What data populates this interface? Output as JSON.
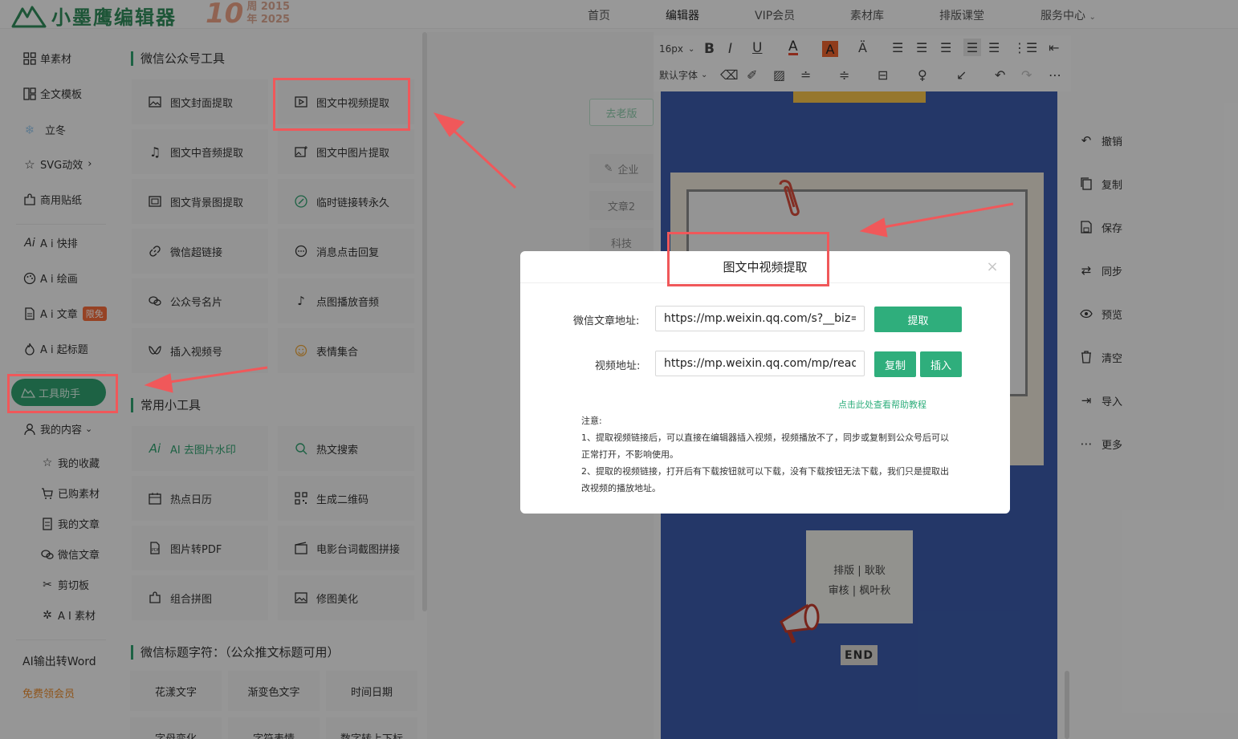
{
  "header": {
    "brand": "小墨鹰编辑器",
    "anniversary_number": "10",
    "anniversary_line1": "周 2015",
    "anniversary_line2": "年 2025",
    "nav": [
      {
        "label": "首页"
      },
      {
        "label": "编辑器"
      },
      {
        "label": "VIP会员"
      },
      {
        "label": "素材库"
      },
      {
        "label": "排版课堂"
      },
      {
        "label": "服务中心"
      }
    ]
  },
  "sidebar": {
    "items": [
      {
        "label": "单素材",
        "icon": "grid-icon"
      },
      {
        "label": "全文模板",
        "icon": "template-icon"
      },
      {
        "label": "立冬",
        "icon": "snowflake-icon"
      },
      {
        "label": "SVG动效",
        "icon": "star-icon"
      },
      {
        "label": "商用贴纸",
        "icon": "puzzle-icon"
      },
      {
        "label": "A i 快排",
        "icon": "ai-icon"
      },
      {
        "label": "A i 绘画",
        "icon": "palette-icon"
      },
      {
        "label": "A i 文章",
        "icon": "doc-icon",
        "badge": "限免"
      },
      {
        "label": "A i 起标题",
        "icon": "fire-icon"
      }
    ],
    "tool_helper": "工具助手",
    "my_content": "我的内容",
    "sub_items": [
      {
        "label": "我的收藏",
        "icon": "star-icon"
      },
      {
        "label": "已购素材",
        "icon": "cart-icon"
      },
      {
        "label": "我的文章",
        "icon": "doc-icon"
      },
      {
        "label": "微信文章",
        "icon": "wechat-icon"
      },
      {
        "label": "剪切板",
        "icon": "scissors-icon"
      },
      {
        "label": "A I 素材",
        "icon": "sparkle-icon"
      }
    ],
    "ai_word": "AI输出转Word",
    "free_vip": "免费领会员"
  },
  "panel": {
    "section1": "微信公众号工具",
    "tools1": [
      {
        "label": "图文封面提取"
      },
      {
        "label": "图文中视频提取"
      },
      {
        "label": "图文中音频提取"
      },
      {
        "label": "图文中图片提取"
      },
      {
        "label": "图文背景图提取"
      },
      {
        "label": "临时链接转永久"
      },
      {
        "label": "微信超链接"
      },
      {
        "label": "消息点击回复"
      },
      {
        "label": "公众号名片"
      },
      {
        "label": "点图播放音频"
      },
      {
        "label": "插入视频号"
      },
      {
        "label": "表情集合"
      }
    ],
    "section2": "常用小工具",
    "tools2": [
      {
        "label": "AI 去图片水印"
      },
      {
        "label": "热文搜索"
      },
      {
        "label": "热点日历"
      },
      {
        "label": "生成二维码"
      },
      {
        "label": "图片转PDF"
      },
      {
        "label": "电影台词截图拼接"
      },
      {
        "label": "组合拼图"
      },
      {
        "label": "修图美化"
      }
    ],
    "section3": "微信标题字符：（公众推文标题可用）",
    "chips": [
      "花漾文字",
      "渐变色文字",
      "时间日期",
      "字母变化",
      "字符表情",
      "数字转上下标"
    ]
  },
  "middle": {
    "old_version": "去老版",
    "tabs": [
      "企业",
      "文章2",
      "科技"
    ]
  },
  "toolbar": {
    "font_size": "16px",
    "font_family": "默认字体"
  },
  "editor": {
    "credit1": "排版 | 耿耿",
    "credit2": "审核 | 枫叶秋",
    "end": "END"
  },
  "right_actions": [
    "撤销",
    "复制",
    "保存",
    "同步",
    "预览",
    "清空",
    "导入",
    "更多"
  ],
  "dialog": {
    "title": "图文中视频提取",
    "label_article": "微信文章地址:",
    "article_value": "https://mp.weixin.qq.com/s?__biz=M",
    "extract_btn": "提取",
    "label_video": "视频地址:",
    "video_value": "https://mp.weixin.qq.com/mp/readt",
    "copy_btn": "复制",
    "insert_btn": "插入",
    "help_link": "点击此处查看帮助教程",
    "note_title": "注意:",
    "note1": "1、提取视频链接后，可以直接在编辑器插入视频，视频播放不了，同步或复制到公众号后可以正常打开，不影响使用。",
    "note2": "2、提取的视频链接，打开后有下载按钮就可以下载，没有下载按钮无法下载，我们只是提取出改视频的播放地址。"
  },
  "colors": {
    "brand_green": "#2f9e6e",
    "annotation_red": "#f0585a",
    "canvas_blue": "#3a5aa8"
  }
}
